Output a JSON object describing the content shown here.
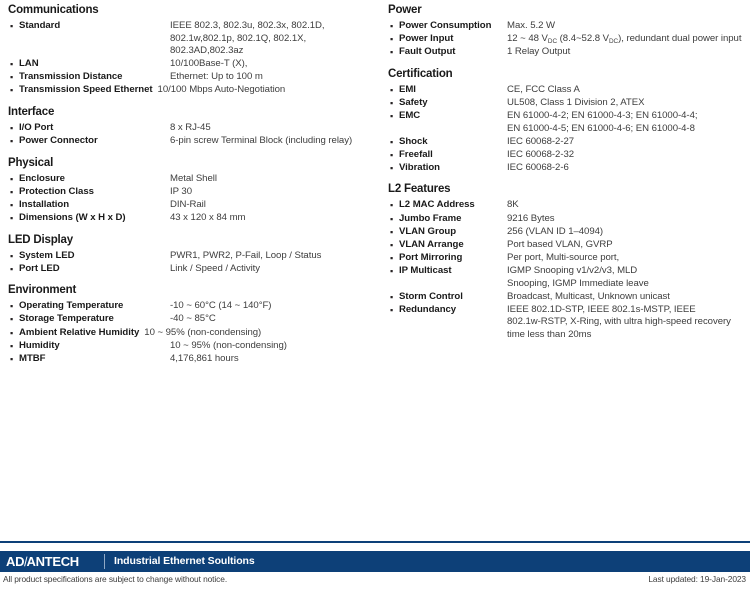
{
  "left_column": [
    {
      "title": "Communications",
      "rows": [
        {
          "label": "Standard",
          "lines": [
            "IEEE 802.3, 802.3u, 802.3x, 802.1D,",
            "802.1w,802.1p, 802.1Q, 802.1X,",
            "802.3AD,802.3az"
          ]
        },
        {
          "label": "LAN",
          "lines": [
            "10/100Base-T (X),"
          ]
        },
        {
          "label": "Transmission Distance",
          "lines": [
            "Ethernet: Up to 100 m"
          ]
        },
        {
          "label": "Transmission Speed Ethernet",
          "wide": true,
          "lines": [
            "10/100 Mbps Auto-Negotiation"
          ]
        }
      ]
    },
    {
      "title": "Interface",
      "rows": [
        {
          "label": "I/O Port",
          "lines": [
            "8 x RJ-45"
          ]
        },
        {
          "label": "Power Connector",
          "lines": [
            "6-pin screw Terminal Block (including relay)"
          ]
        }
      ]
    },
    {
      "title": "Physical",
      "rows": [
        {
          "label": "Enclosure",
          "lines": [
            "Metal Shell"
          ]
        },
        {
          "label": "Protection Class",
          "lines": [
            "IP 30"
          ]
        },
        {
          "label": "Installation",
          "lines": [
            "DIN-Rail"
          ]
        },
        {
          "label": "Dimensions (W x H x D)",
          "lines": [
            "43 x 120 x 84 mm"
          ]
        }
      ]
    },
    {
      "title": "LED Display",
      "rows": [
        {
          "label": "System LED",
          "lines": [
            "PWR1, PWR2, P-Fail, Loop / Status"
          ]
        },
        {
          "label": "Port LED",
          "lines": [
            "Link / Speed / Activity"
          ]
        }
      ]
    },
    {
      "title": "Environment",
      "rows": [
        {
          "label": "Operating Temperature",
          "lines": [
            "-10 ~ 60°C (14 ~ 140°F)"
          ]
        },
        {
          "label": "Storage Temperature",
          "lines": [
            "-40 ~ 85°C"
          ]
        },
        {
          "label": "Ambient Relative Humidity",
          "wide": true,
          "lines": [
            "10 ~ 95% (non-condensing)"
          ]
        },
        {
          "label": "Humidity",
          "lines": [
            "10 ~ 95% (non-condensing)"
          ]
        },
        {
          "label": "MTBF",
          "lines": [
            "4,176,861 hours"
          ]
        }
      ]
    }
  ],
  "right_column": [
    {
      "title": "Power",
      "rows": [
        {
          "label": "Power Consumption",
          "lines": [
            "Max. 5.2 W"
          ]
        },
        {
          "label": "Power Input",
          "html_lines": [
            "12 ~ 48 V<sub>DC</sub> (8.4~52.8 V<sub>DC</sub>), redundant dual power input"
          ]
        },
        {
          "label": "Fault Output",
          "lines": [
            "1 Relay Output"
          ]
        }
      ]
    },
    {
      "title": "Certification",
      "rows": [
        {
          "label": "EMI",
          "lines": [
            "CE, FCC Class A"
          ]
        },
        {
          "label": "Safety",
          "lines": [
            "UL508, Class 1 Division 2, ATEX"
          ]
        },
        {
          "label": "EMC",
          "lines": [
            "EN 61000-4-2; EN 61000-4-3; EN 61000-4-4;",
            "EN 61000-4-5; EN 61000-4-6; EN 61000-4-8"
          ]
        },
        {
          "label": "Shock",
          "lines": [
            "IEC 60068-2-27"
          ]
        },
        {
          "label": "Freefall",
          "lines": [
            "IEC 60068-2-32"
          ]
        },
        {
          "label": "Vibration",
          "lines": [
            "IEC 60068-2-6"
          ]
        }
      ]
    },
    {
      "title": "L2 Features",
      "rows": [
        {
          "label": "L2 MAC Address",
          "lines": [
            "8K"
          ]
        },
        {
          "label": "Jumbo Frame",
          "lines": [
            "9216 Bytes"
          ]
        },
        {
          "label": "VLAN Group",
          "lines": [
            "256 (VLAN ID 1–4094)"
          ]
        },
        {
          "label": "VLAN Arrange",
          "lines": [
            "Port based VLAN, GVRP"
          ]
        },
        {
          "label": "Port Mirroring",
          "lines": [
            "Per port, Multi-source port,"
          ]
        },
        {
          "label": "IP Multicast",
          "lines": [
            "IGMP Snooping v1/v2/v3, MLD",
            "Snooping, IGMP Immediate leave"
          ]
        },
        {
          "label": "Storm Control",
          "lines": [
            "Broadcast, Multicast, Unknown unicast"
          ]
        },
        {
          "label": "Redundancy",
          "lines": [
            "IEEE 802.1D-STP, IEEE 802.1s-MSTP, IEEE",
            "802.1w-RSTP, X-Ring, with ultra high-speed recovery",
            "time less than 20ms"
          ]
        }
      ]
    }
  ],
  "footer": {
    "logo_before": "AD",
    "logo_slash": "\\",
    "logo_after": "ANTECH",
    "tagline": "Industrial Ethernet Soultions",
    "disclaimer": "All product specifications are subject to change without notice.",
    "last_updated": "Last updated: 19-Jan-2023",
    "bar_color": "#0d4078"
  }
}
